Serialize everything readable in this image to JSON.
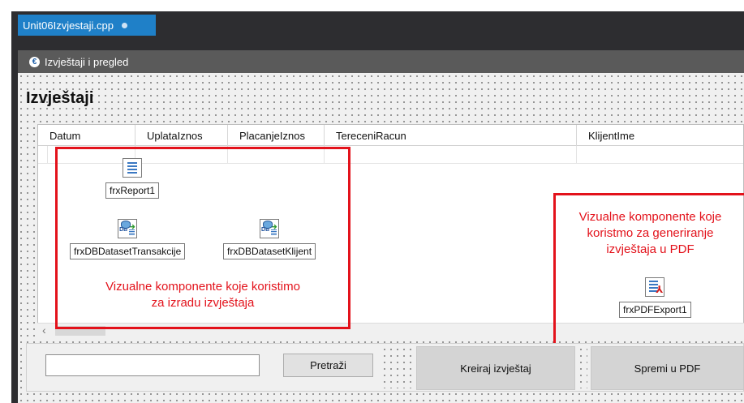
{
  "editor_tab": {
    "label": "Unit06Izvjestaji.cpp"
  },
  "form": {
    "caption": "Izvještaji i pregled",
    "heading": "Izvještaji"
  },
  "grid": {
    "columns": [
      "Datum",
      "UplataIznos",
      "PlacanjeIznos",
      "TereceniRacun",
      "KlijentIme"
    ]
  },
  "components": {
    "report": "frxReport1",
    "dataset_transakcije": "frxDBDatasetTransakcije",
    "dataset_klijent": "frxDBDatasetKlijent",
    "pdf_export": "frxPDFExport1"
  },
  "annotations": {
    "left_line1": "Vizualne komponente koje koristimo",
    "left_line2": "za izradu izvještaja",
    "right_line1": "Vizualne komponente koje",
    "right_line2": "koristmo za generiranje",
    "right_line3": "izvještaja u PDF"
  },
  "controls": {
    "search_value": "",
    "search_button": "Pretraži",
    "create_report_button": "Kreiraj izvještaj",
    "save_pdf_button": "Spremi u PDF"
  },
  "colors": {
    "tab_blue": "#1f80c8",
    "caption_gray": "#5a5a5a",
    "annotation_red": "#e3121b"
  }
}
